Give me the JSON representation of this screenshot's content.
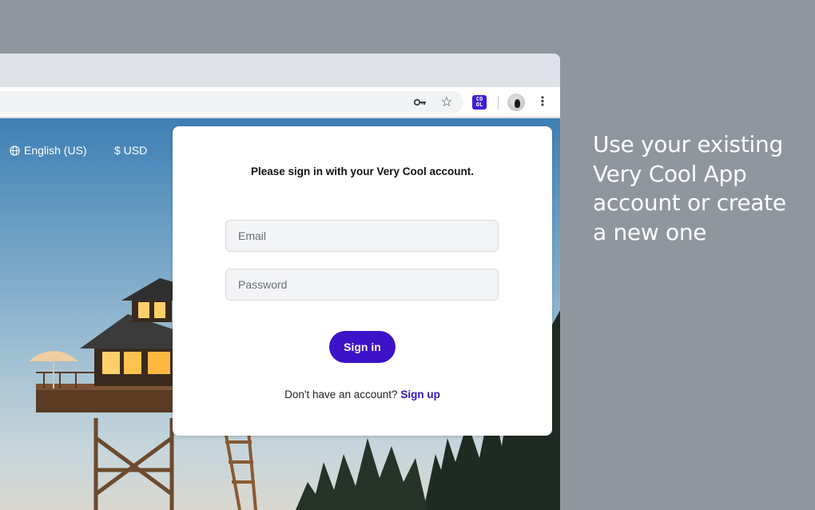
{
  "browser": {
    "toolbar": {
      "icons": [
        "key-icon",
        "star-icon",
        "extension-icon",
        "avatar",
        "menu-icon"
      ],
      "extension_badge": "CO\nOL",
      "star_glyph": "☆",
      "menu_glyph": "⋮"
    }
  },
  "page": {
    "language": "English (US)",
    "currency": "$ USD"
  },
  "signin": {
    "title": "Please sign in with your Very Cool account.",
    "email_placeholder": "Email",
    "password_placeholder": "Password",
    "button_label": "Sign in",
    "signup_prompt": "Don't have an account?",
    "signup_link": "Sign up",
    "accent_color": "#3d12c9"
  },
  "caption": {
    "text": "Use your existing Very Cool App account or create a new one"
  }
}
